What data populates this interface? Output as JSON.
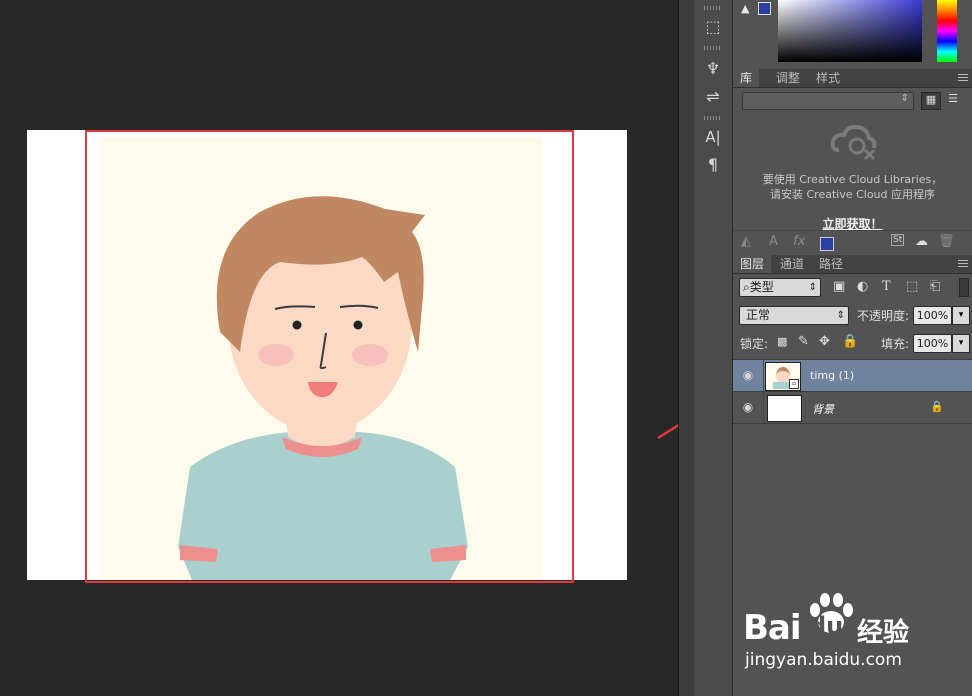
{
  "colors": {
    "canvas_bg": "#282828",
    "selection_border": "#e0393e",
    "panel_bg": "#535353",
    "selected_layer": "#6f829e",
    "arrow": "#e0393e",
    "foreground_swatch": "#2b3ea2"
  },
  "library_panel": {
    "tabs": [
      "库",
      "调整",
      "样式"
    ],
    "message_line1": "要使用 Creative Cloud Libraries，",
    "message_line2": "请安装 Creative Cloud 应用程序",
    "link": "立即获取！"
  },
  "layers_panel": {
    "tabs": [
      "图层",
      "通道",
      "路径"
    ],
    "filter_kind": "类型",
    "blend_mode": "正常",
    "opacity_label": "不透明度:",
    "opacity_value": "100%",
    "lock_label": "锁定:",
    "fill_label": "填充:",
    "fill_value": "100%",
    "layers": [
      {
        "name": "timg (1)",
        "selected": true,
        "visible": true
      },
      {
        "name": "背景",
        "selected": false,
        "visible": true,
        "locked": true
      }
    ]
  },
  "tool_icons": [
    "path-select-icon",
    "puppet-icon",
    "adjust-icon",
    "text-char-icon",
    "paragraph-icon"
  ],
  "watermark": {
    "brand": "Bai",
    "brand2": "du",
    "cn": "经验",
    "url": "jingyan.baidu.com"
  }
}
